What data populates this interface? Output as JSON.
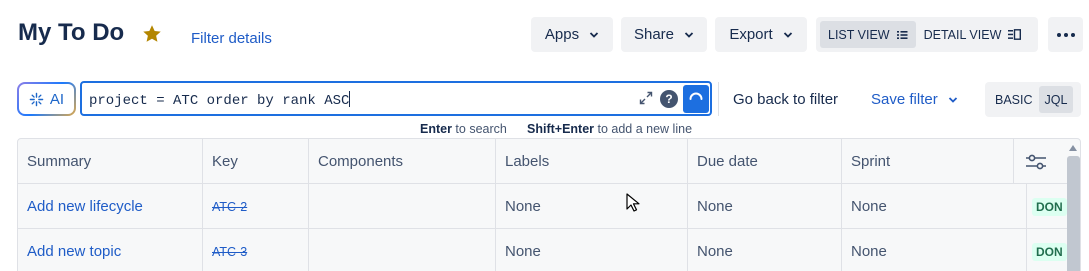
{
  "header": {
    "title": "My To Do",
    "filter_details": "Filter details",
    "buttons": {
      "apps": "Apps",
      "share": "Share",
      "export": "Export"
    },
    "views": {
      "list": "LIST VIEW",
      "detail": "DETAIL VIEW"
    },
    "accent": "#1f5cc7",
    "star_color": "#b38600"
  },
  "search": {
    "ai_label": "AI",
    "query": "project = ATC order by rank ASC",
    "help_label": "?",
    "go_back": "Go back to filter",
    "save_filter": "Save filter",
    "mode_basic": "BASIC",
    "mode_jql": "JQL",
    "hint": {
      "enter_key": "Enter",
      "enter_text": " to search",
      "shift_key": "Shift+Enter",
      "shift_text": " to add a new line"
    }
  },
  "table": {
    "columns": [
      "Summary",
      "Key",
      "Components",
      "Labels",
      "Due date",
      "Sprint"
    ],
    "rows": [
      {
        "summary": "Add new lifecycle",
        "key": "ATC-2",
        "components": "",
        "labels": "None",
        "due": "None",
        "sprint": "None",
        "status": "DON"
      },
      {
        "summary": "Add new topic",
        "key": "ATC-3",
        "components": "",
        "labels": "None",
        "due": "None",
        "sprint": "None",
        "status": "DON"
      }
    ]
  }
}
